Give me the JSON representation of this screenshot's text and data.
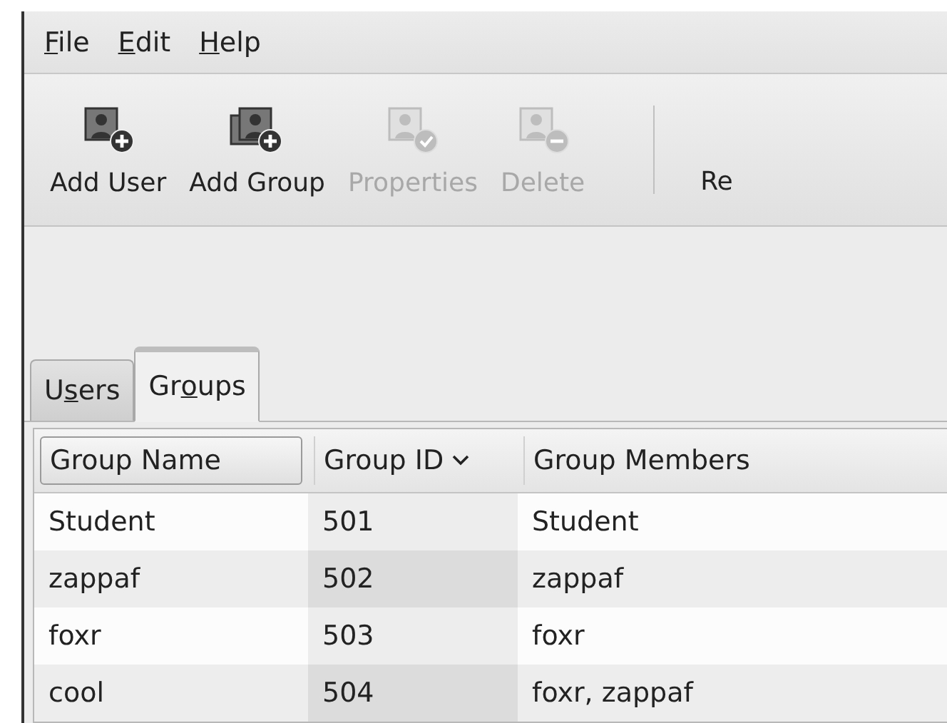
{
  "menu": [
    {
      "key": "F",
      "post": "ile"
    },
    {
      "key": "E",
      "post": "dit"
    },
    {
      "key": "H",
      "post": "elp"
    }
  ],
  "toolbar": [
    {
      "kind": "add-user",
      "label": "Add User",
      "disabled": false
    },
    {
      "kind": "add-group",
      "label": "Add Group",
      "disabled": false
    },
    {
      "kind": "properties",
      "label": "Properties",
      "disabled": true
    },
    {
      "kind": "delete",
      "label": "Delete",
      "disabled": true
    },
    {
      "kind": "separator"
    },
    {
      "kind": "text",
      "label": "Re",
      "disabled": false
    }
  ],
  "tabs": [
    {
      "pre": "U",
      "key": "s",
      "post": "ers",
      "selected": false
    },
    {
      "pre": "Gr",
      "key": "o",
      "post": "ups",
      "selected": true
    }
  ],
  "table": {
    "columns": [
      {
        "label": "Group Name",
        "focused": true,
        "sorted": false
      },
      {
        "label": "Group ID",
        "focused": false,
        "sorted": true
      },
      {
        "label": "Group Members",
        "focused": false,
        "sorted": false
      }
    ],
    "rows": [
      [
        "Student",
        "501",
        "Student"
      ],
      [
        "zappaf",
        "502",
        "zappaf"
      ],
      [
        "foxr",
        "503",
        "foxr"
      ],
      [
        "cool",
        "504",
        "foxr, zappaf"
      ]
    ]
  }
}
